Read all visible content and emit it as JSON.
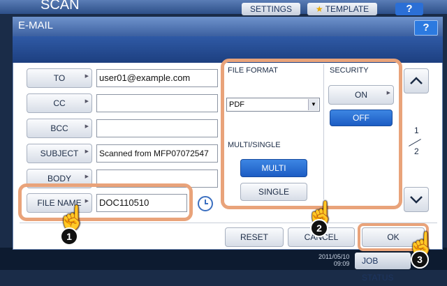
{
  "background": {
    "title": "SCAN",
    "settings_label": "SETTINGS",
    "template_label": "TEMPLATE",
    "help_label": "?",
    "date": "2011/05/10",
    "time": "09:09",
    "job_status_label": "JOB STATUS"
  },
  "dialog": {
    "title": "E-MAIL",
    "help_label": "?"
  },
  "fields": [
    {
      "label": "TO",
      "value": "user01@example.com"
    },
    {
      "label": "CC",
      "value": ""
    },
    {
      "label": "BCC",
      "value": ""
    },
    {
      "label": "SUBJECT",
      "value": "Scanned from MFP07072547"
    },
    {
      "label": "BODY",
      "value": ""
    },
    {
      "label": "FILE NAME",
      "value": "DOC110510"
    }
  ],
  "panel": {
    "file_format_label": "FILE FORMAT",
    "file_format_value": "PDF",
    "multi_single_label": "MULTI/SINGLE",
    "multi_label": "MULTI",
    "single_label": "SINGLE",
    "selected_mode": "MULTI",
    "security_label": "SECURITY",
    "on_label": "ON",
    "off_label": "OFF",
    "security_value": "OFF"
  },
  "pager": {
    "current": "1",
    "total": "2"
  },
  "actions": {
    "reset_label": "RESET",
    "cancel_label": "CANCEL",
    "ok_label": "OK"
  },
  "steps": [
    "1",
    "2",
    "3"
  ],
  "colors": {
    "accent": "#2c7ae0",
    "highlight": "#e9a37a",
    "selected": "#1c5cc3"
  }
}
